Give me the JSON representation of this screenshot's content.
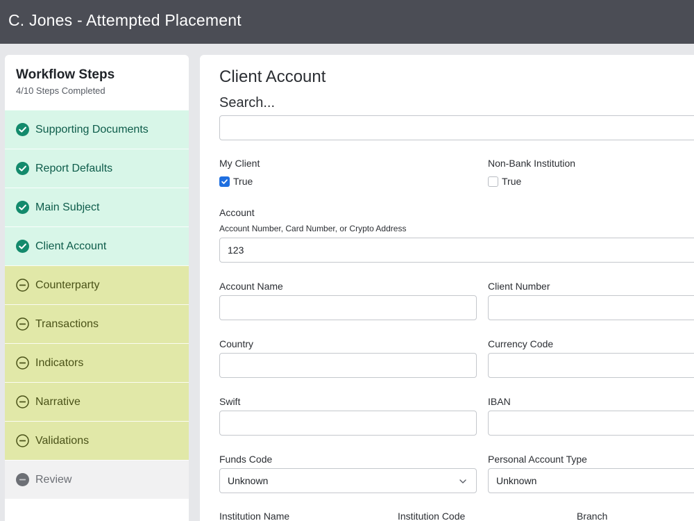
{
  "header": {
    "title": "C. Jones - Attempted Placement"
  },
  "sidebar": {
    "title": "Workflow Steps",
    "progress": "4/10 Steps Completed",
    "steps": [
      {
        "label": "Supporting Documents",
        "status": "complete"
      },
      {
        "label": "Report Defaults",
        "status": "complete"
      },
      {
        "label": "Main Subject",
        "status": "complete"
      },
      {
        "label": "Client Account",
        "status": "complete"
      },
      {
        "label": "Counterparty",
        "status": "incomplete"
      },
      {
        "label": "Transactions",
        "status": "incomplete"
      },
      {
        "label": "Indicators",
        "status": "incomplete"
      },
      {
        "label": "Narrative",
        "status": "incomplete"
      },
      {
        "label": "Validations",
        "status": "incomplete"
      },
      {
        "label": "Review",
        "status": "locked"
      }
    ]
  },
  "main": {
    "title": "Client Account",
    "search": {
      "label": "Search...",
      "value": ""
    },
    "my_client": {
      "label": "My Client",
      "option": "True",
      "checked": true
    },
    "non_bank": {
      "label": "Non-Bank Institution",
      "option": "True",
      "checked": false
    },
    "account": {
      "label": "Account",
      "hint": "Account Number, Card Number, or Crypto Address",
      "value": "123"
    },
    "account_name": {
      "label": "Account Name",
      "value": ""
    },
    "client_number": {
      "label": "Client Number",
      "value": ""
    },
    "country": {
      "label": "Country",
      "value": ""
    },
    "currency_code": {
      "label": "Currency Code",
      "value": ""
    },
    "swift": {
      "label": "Swift",
      "value": ""
    },
    "iban": {
      "label": "IBAN",
      "value": ""
    },
    "funds_code": {
      "label": "Funds Code",
      "value": "Unknown"
    },
    "personal_account_type": {
      "label": "Personal Account Type",
      "value": "Unknown"
    },
    "institution_name": {
      "label": "Institution Name"
    },
    "institution_code": {
      "label": "Institution Code"
    },
    "branch": {
      "label": "Branch"
    }
  },
  "colors": {
    "header_bg": "#4b4d55",
    "complete_bg": "#d8f6e8",
    "complete_icon": "#138a6c",
    "incomplete_bg": "#e1e8a8",
    "review_bg": "#f1f1f2",
    "checkbox_accent": "#1f6fe0"
  }
}
